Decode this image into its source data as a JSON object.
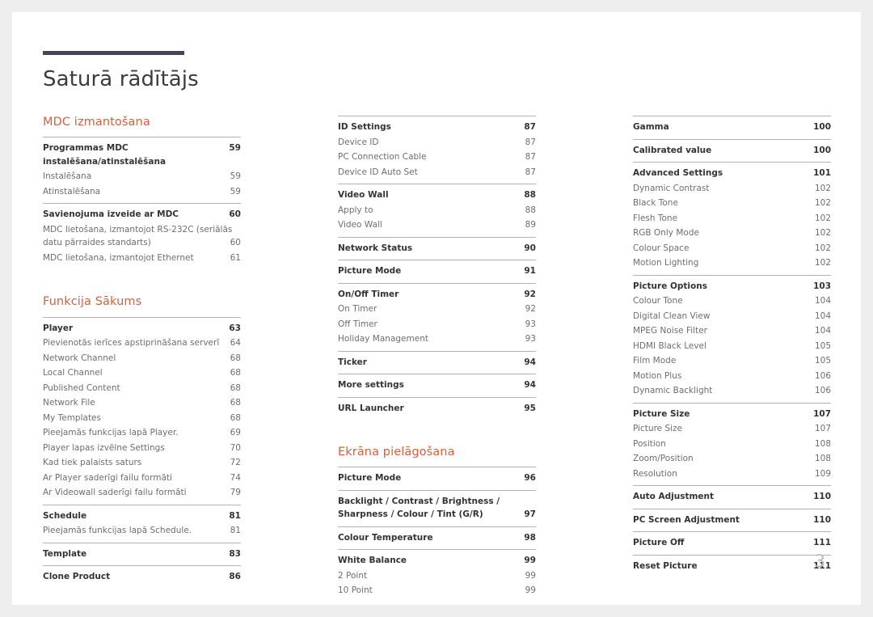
{
  "document": {
    "title": "Saturā rādītājs",
    "page_number": "3",
    "accent_color": "#d4603c",
    "rule_color": "#474456"
  },
  "columns": [
    {
      "name": "column-1",
      "sections": [
        {
          "heading": "MDC izmantošana",
          "groups": [
            {
              "entries": [
                {
                  "label": "Programmas MDC instalēšana/atinstalēšana",
                  "page": "59",
                  "bold": true
                },
                {
                  "label": "Instalēšana",
                  "page": "59",
                  "bold": false
                },
                {
                  "label": "Atinstalēšana",
                  "page": "59",
                  "bold": false
                }
              ]
            },
            {
              "entries": [
                {
                  "label": "Savienojuma izveide ar MDC",
                  "page": "60",
                  "bold": true
                },
                {
                  "label_line1": "MDC lietošana, izmantojot RS-232C (seriālās",
                  "label": "datu pārraides standarts)",
                  "page": "60",
                  "bold": false,
                  "wrapped": true
                },
                {
                  "label": "MDC lietošana, izmantojot Ethernet",
                  "page": "61",
                  "bold": false
                }
              ]
            }
          ]
        },
        {
          "heading": "Funkcija Sākums",
          "groups": [
            {
              "entries": [
                {
                  "label": "Player",
                  "page": "63",
                  "bold": true
                },
                {
                  "label": "Pievienotās ierīces apstiprināšana serverī",
                  "page": "64",
                  "bold": false
                },
                {
                  "label": "Network Channel",
                  "page": "68",
                  "bold": false
                },
                {
                  "label": "Local Channel",
                  "page": "68",
                  "bold": false
                },
                {
                  "label": "Published Content",
                  "page": "68",
                  "bold": false
                },
                {
                  "label": "Network File",
                  "page": "68",
                  "bold": false
                },
                {
                  "label": "My Templates",
                  "page": "68",
                  "bold": false
                },
                {
                  "label": "Pieejamās funkcijas lapā Player.",
                  "page": "69",
                  "bold": false
                },
                {
                  "label": "Player lapas izvēlne Settings",
                  "page": "70",
                  "bold": false
                },
                {
                  "label": "Kad tiek palaists saturs",
                  "page": "72",
                  "bold": false
                },
                {
                  "label": "Ar Player saderīgi failu formāti",
                  "page": "74",
                  "bold": false
                },
                {
                  "label": "Ar Videowall saderīgi failu formāti",
                  "page": "79",
                  "bold": false
                }
              ]
            },
            {
              "entries": [
                {
                  "label": "Schedule",
                  "page": "81",
                  "bold": true
                },
                {
                  "label": "Pieejamās funkcijas lapā Schedule.",
                  "page": "81",
                  "bold": false
                }
              ]
            },
            {
              "entries": [
                {
                  "label": "Template",
                  "page": "83",
                  "bold": true
                }
              ]
            },
            {
              "entries": [
                {
                  "label": "Clone Product",
                  "page": "86",
                  "bold": true
                }
              ]
            }
          ]
        }
      ]
    },
    {
      "name": "column-2",
      "sections": [
        {
          "heading": "",
          "groups": [
            {
              "entries": [
                {
                  "label": "ID Settings",
                  "page": "87",
                  "bold": true
                },
                {
                  "label": "Device ID",
                  "page": "87",
                  "bold": false
                },
                {
                  "label": "PC Connection Cable",
                  "page": "87",
                  "bold": false
                },
                {
                  "label": "Device ID Auto Set",
                  "page": "87",
                  "bold": false
                }
              ]
            },
            {
              "entries": [
                {
                  "label": "Video Wall",
                  "page": "88",
                  "bold": true
                },
                {
                  "label": "Apply to",
                  "page": "88",
                  "bold": false
                },
                {
                  "label": "Video Wall",
                  "page": "89",
                  "bold": false
                }
              ]
            },
            {
              "entries": [
                {
                  "label": "Network Status",
                  "page": "90",
                  "bold": true
                }
              ]
            },
            {
              "entries": [
                {
                  "label": "Picture Mode",
                  "page": "91",
                  "bold": true
                }
              ]
            },
            {
              "entries": [
                {
                  "label": "On/Off Timer",
                  "page": "92",
                  "bold": true
                },
                {
                  "label": "On Timer",
                  "page": "92",
                  "bold": false
                },
                {
                  "label": "Off Timer",
                  "page": "93",
                  "bold": false
                },
                {
                  "label": "Holiday Management",
                  "page": "93",
                  "bold": false
                }
              ]
            },
            {
              "entries": [
                {
                  "label": "Ticker",
                  "page": "94",
                  "bold": true
                }
              ]
            },
            {
              "entries": [
                {
                  "label": "More settings",
                  "page": "94",
                  "bold": true
                }
              ]
            },
            {
              "entries": [
                {
                  "label": "URL Launcher",
                  "page": "95",
                  "bold": true
                }
              ]
            }
          ]
        },
        {
          "heading": "Ekrāna pielāgošana",
          "groups": [
            {
              "entries": [
                {
                  "label": "Picture Mode",
                  "page": "96",
                  "bold": true
                }
              ]
            },
            {
              "entries": [
                {
                  "label_line1": "Backlight / Contrast / Brightness /",
                  "label": "Sharpness / Colour / Tint (G/R)",
                  "page": "97",
                  "bold": true,
                  "wrapped": true
                }
              ]
            },
            {
              "entries": [
                {
                  "label": "Colour Temperature",
                  "page": "98",
                  "bold": true
                }
              ]
            },
            {
              "entries": [
                {
                  "label": "White Balance",
                  "page": "99",
                  "bold": true
                },
                {
                  "label": "2 Point",
                  "page": "99",
                  "bold": false
                },
                {
                  "label": "10 Point",
                  "page": "99",
                  "bold": false
                }
              ]
            }
          ]
        }
      ]
    },
    {
      "name": "column-3",
      "sections": [
        {
          "heading": "",
          "groups": [
            {
              "entries": [
                {
                  "label": "Gamma",
                  "page": "100",
                  "bold": true
                }
              ]
            },
            {
              "entries": [
                {
                  "label": "Calibrated value",
                  "page": "100",
                  "bold": true
                }
              ]
            },
            {
              "entries": [
                {
                  "label": "Advanced Settings",
                  "page": "101",
                  "bold": true
                },
                {
                  "label": "Dynamic Contrast",
                  "page": "102",
                  "bold": false
                },
                {
                  "label": "Black Tone",
                  "page": "102",
                  "bold": false
                },
                {
                  "label": "Flesh Tone",
                  "page": "102",
                  "bold": false
                },
                {
                  "label": "RGB Only Mode",
                  "page": "102",
                  "bold": false
                },
                {
                  "label": "Colour Space",
                  "page": "102",
                  "bold": false
                },
                {
                  "label": "Motion Lighting",
                  "page": "102",
                  "bold": false
                }
              ]
            },
            {
              "entries": [
                {
                  "label": "Picture Options",
                  "page": "103",
                  "bold": true
                },
                {
                  "label": "Colour Tone",
                  "page": "104",
                  "bold": false
                },
                {
                  "label": "Digital Clean View",
                  "page": "104",
                  "bold": false
                },
                {
                  "label": "MPEG Noise Filter",
                  "page": "104",
                  "bold": false
                },
                {
                  "label": "HDMI Black Level",
                  "page": "105",
                  "bold": false
                },
                {
                  "label": "Film Mode",
                  "page": "105",
                  "bold": false
                },
                {
                  "label": "Motion Plus",
                  "page": "106",
                  "bold": false
                },
                {
                  "label": "Dynamic Backlight",
                  "page": "106",
                  "bold": false
                }
              ]
            },
            {
              "entries": [
                {
                  "label": "Picture Size",
                  "page": "107",
                  "bold": true
                },
                {
                  "label": "Picture Size",
                  "page": "107",
                  "bold": false
                },
                {
                  "label": "Position",
                  "page": "108",
                  "bold": false
                },
                {
                  "label": "Zoom/Position",
                  "page": "108",
                  "bold": false
                },
                {
                  "label": "Resolution",
                  "page": "109",
                  "bold": false
                }
              ]
            },
            {
              "entries": [
                {
                  "label": "Auto Adjustment",
                  "page": "110",
                  "bold": true
                }
              ]
            },
            {
              "entries": [
                {
                  "label": "PC Screen Adjustment",
                  "page": "110",
                  "bold": true
                }
              ]
            },
            {
              "entries": [
                {
                  "label": "Picture Off",
                  "page": "111",
                  "bold": true
                }
              ]
            },
            {
              "entries": [
                {
                  "label": "Reset Picture",
                  "page": "111",
                  "bold": true
                }
              ]
            }
          ]
        }
      ]
    }
  ]
}
